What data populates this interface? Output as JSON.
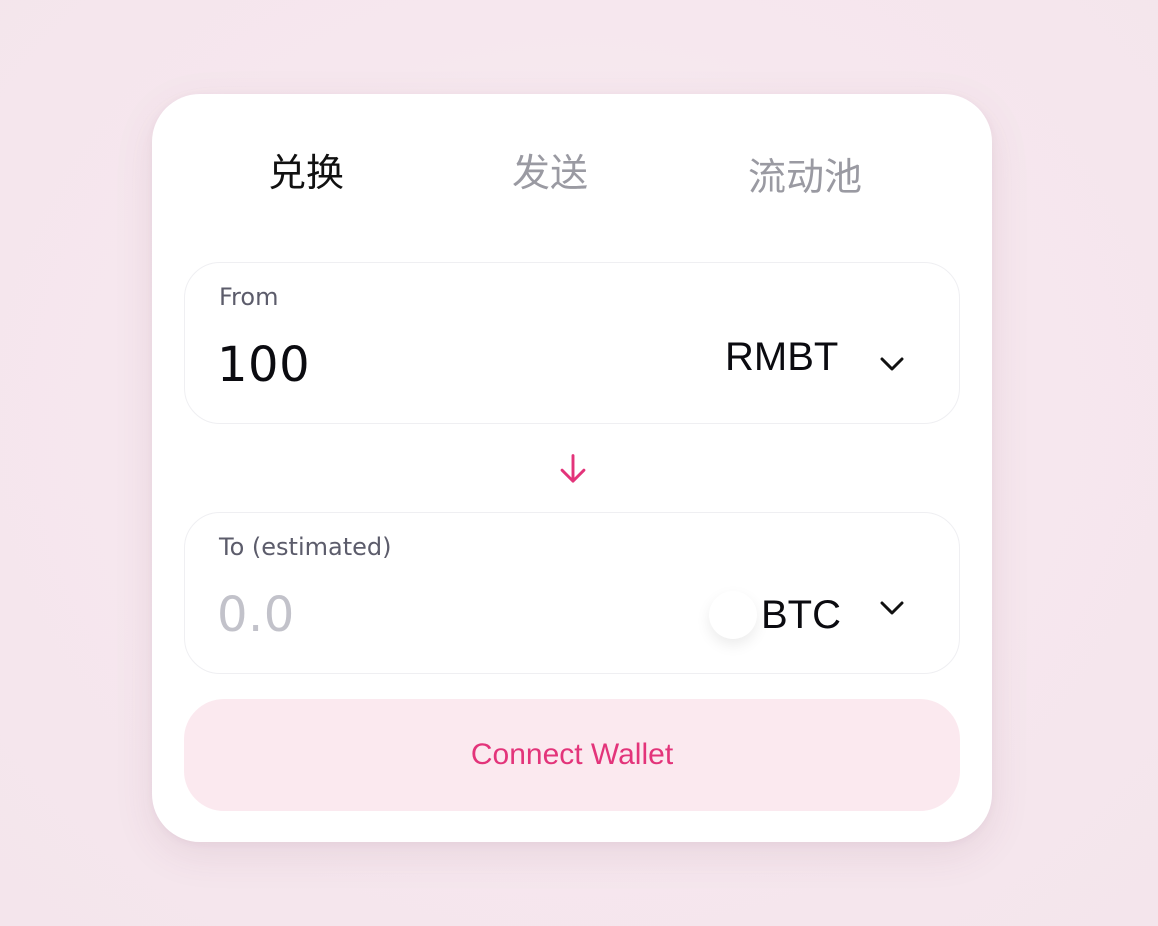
{
  "tabs": [
    {
      "label": "兑换",
      "active": true
    },
    {
      "label": "发送",
      "active": false
    },
    {
      "label": "流动池",
      "active": false
    }
  ],
  "from": {
    "label": "From",
    "amount": "100",
    "token": "RMBT",
    "token_icon": "chevron-down-icon"
  },
  "swap": {
    "icon": "arrow-down-icon",
    "color": "#e3347a"
  },
  "to": {
    "label": "To (estimated)",
    "amount_placeholder": "0.0",
    "token": "BTC",
    "token_icon": "chevron-down-icon"
  },
  "action": {
    "connect_label": "Connect Wallet",
    "text_color": "#e3347a",
    "background": "#fbe9ef"
  }
}
